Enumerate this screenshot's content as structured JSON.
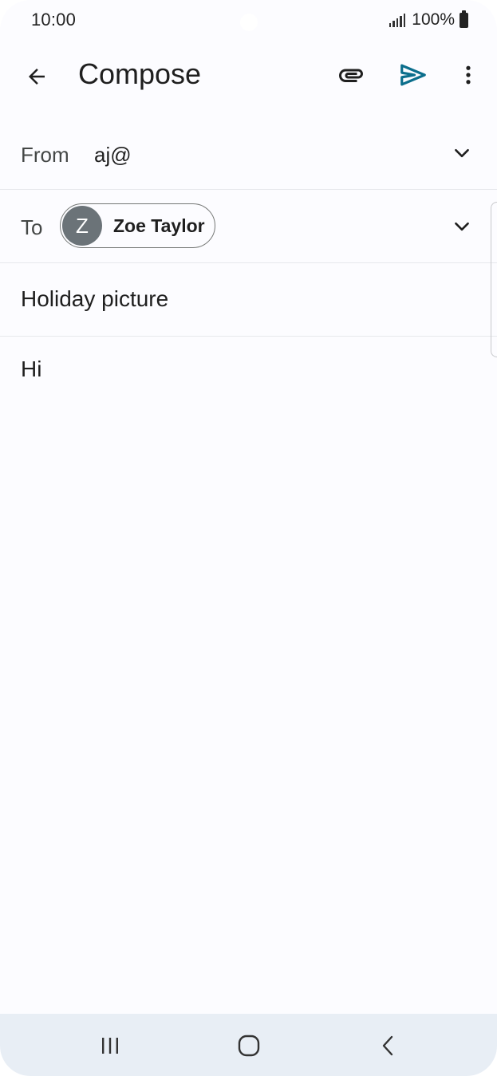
{
  "status_bar": {
    "time": "10:00",
    "battery": "100%"
  },
  "app_bar": {
    "title": "Compose",
    "icons": [
      "back-arrow-icon",
      "paperclip-icon",
      "send-icon",
      "more-vert-icon"
    ]
  },
  "from": {
    "label": "From",
    "value": "aj@"
  },
  "to": {
    "label": "To",
    "recipient": {
      "initial": "Z",
      "name": "Zoe Taylor"
    }
  },
  "subject": "Holiday picture",
  "body": "Hi",
  "colors": {
    "accent": "#0b6e8c",
    "avatar": "#6b7378",
    "nav_bar": "#e8eef5"
  },
  "nav": {
    "icons": [
      "recents-icon",
      "home-icon",
      "nav-back-icon"
    ]
  }
}
